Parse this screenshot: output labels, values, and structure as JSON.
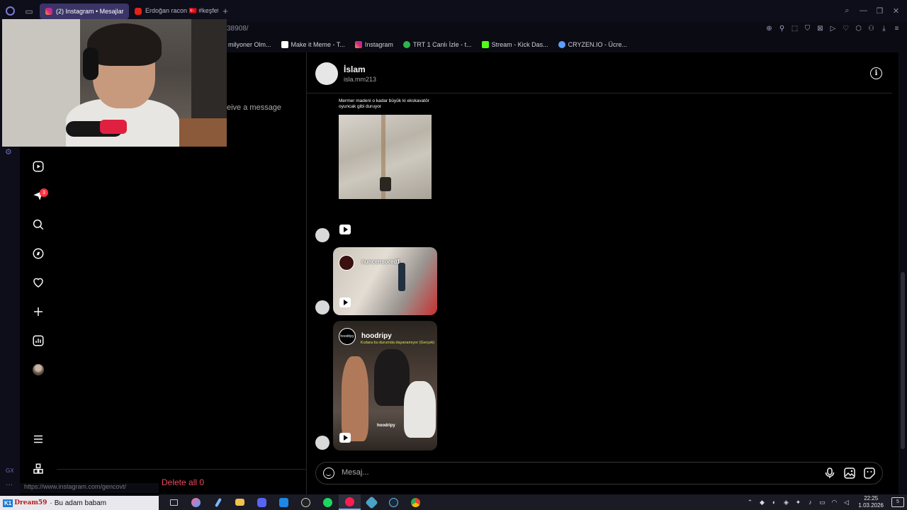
{
  "browser": {
    "tabs": [
      {
        "label": "(2) Instagram • Mesajlar",
        "active": true,
        "favicon": "instagram-icon"
      },
      {
        "label": "Erdoğan racon 🇹🇷 #keşfet",
        "active": false,
        "favicon": "youtube-icon"
      }
    ],
    "address_fragment": "38908/",
    "bookmarks": [
      {
        "label": "milyoner Olm...",
        "icon": "bookmark-icon"
      },
      {
        "label": "Make it Meme - T...",
        "icon": "mim-icon"
      },
      {
        "label": "Instagram",
        "icon": "instagram-icon"
      },
      {
        "label": "TRT 1 Canlı İzle - t...",
        "icon": "trt-icon"
      },
      {
        "label": "Stream - Kick Das...",
        "icon": "kick-icon"
      },
      {
        "label": "CRYZEN.IO - Ücre...",
        "icon": "cryzen-icon"
      }
    ],
    "opera_sidebar_label": "GX",
    "status_url": "https://www.instagram.com/gencovt/"
  },
  "instagram": {
    "notification_count": "3",
    "inbox_hint": "eive a message",
    "delete_all": "Delete all 0",
    "chat": {
      "name": "İslam",
      "username": "isla.mm213",
      "messages": [
        {
          "type": "reel",
          "caption": "Mermer madeni o kadar büyük ki ekskavatör oyuncak gibi duruyor"
        },
        {
          "type": "reel",
          "account": "nuncensored1"
        },
        {
          "type": "reel",
          "account": "hoodripy",
          "subtitle": "Kızlara bu durumda dayanamıyor (Gerçek)",
          "watermark": "hoodripy",
          "logo_text": "hoodripy"
        }
      ]
    },
    "composer": {
      "placeholder": "Mesaj..."
    }
  },
  "stream_chat": {
    "badge": "K1",
    "user": "Dream59",
    "message": "Bu adam babam"
  },
  "taskbar": {
    "time": "22:25",
    "date": "1.03.2026",
    "notifications": "5"
  },
  "colors": {
    "accent_tab": "#3a3566",
    "badge": "#ff3040",
    "delete": "#ed4956"
  }
}
